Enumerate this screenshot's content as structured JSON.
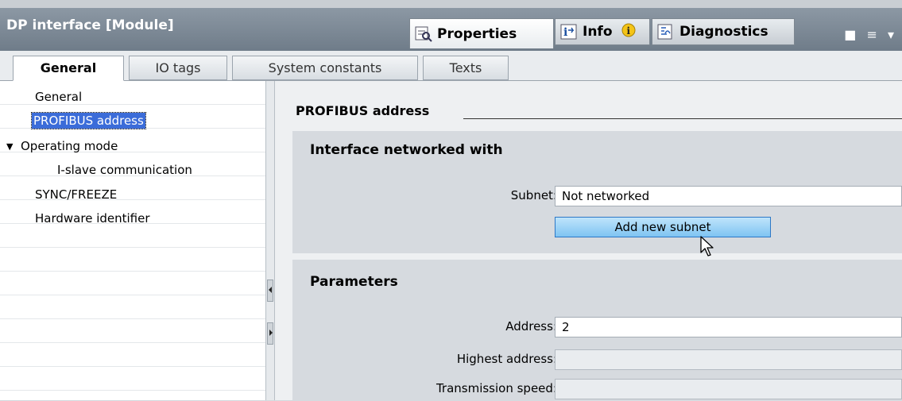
{
  "window": {
    "title": "DP interface [Module]",
    "controls": "■ ≡ ▾"
  },
  "inspector_tabs": [
    {
      "label": "Properties",
      "icon": "properties-icon"
    },
    {
      "label": "Info",
      "icon": "info-icon"
    },
    {
      "label": "Diagnostics",
      "icon": "diagnostics-icon"
    }
  ],
  "sub_tabs": [
    "General",
    "IO tags",
    "System constants",
    "Texts"
  ],
  "nav": {
    "items": [
      "General",
      "PROFIBUS address",
      "Operating mode",
      "I-slave communication",
      "SYNC/FREEZE",
      "Hardware identifier"
    ],
    "expand_glyph": "▼"
  },
  "content": {
    "section_title": "PROFIBUS address",
    "interface_group": {
      "title": "Interface networked with",
      "subnet_label": "Subnet:",
      "subnet_value": "Not networked",
      "add_subnet_label": "Add new subnet"
    },
    "parameters_group": {
      "title": "Parameters",
      "address_label": "Address:",
      "address_value": "2",
      "highest_label": "Highest address:",
      "highest_value": "",
      "speed_label": "Transmission speed:",
      "speed_value": ""
    }
  },
  "colors": {
    "selection": "#3b6cd9",
    "button_blue": "#7fc4f2",
    "titlebar": "#7b8794"
  }
}
